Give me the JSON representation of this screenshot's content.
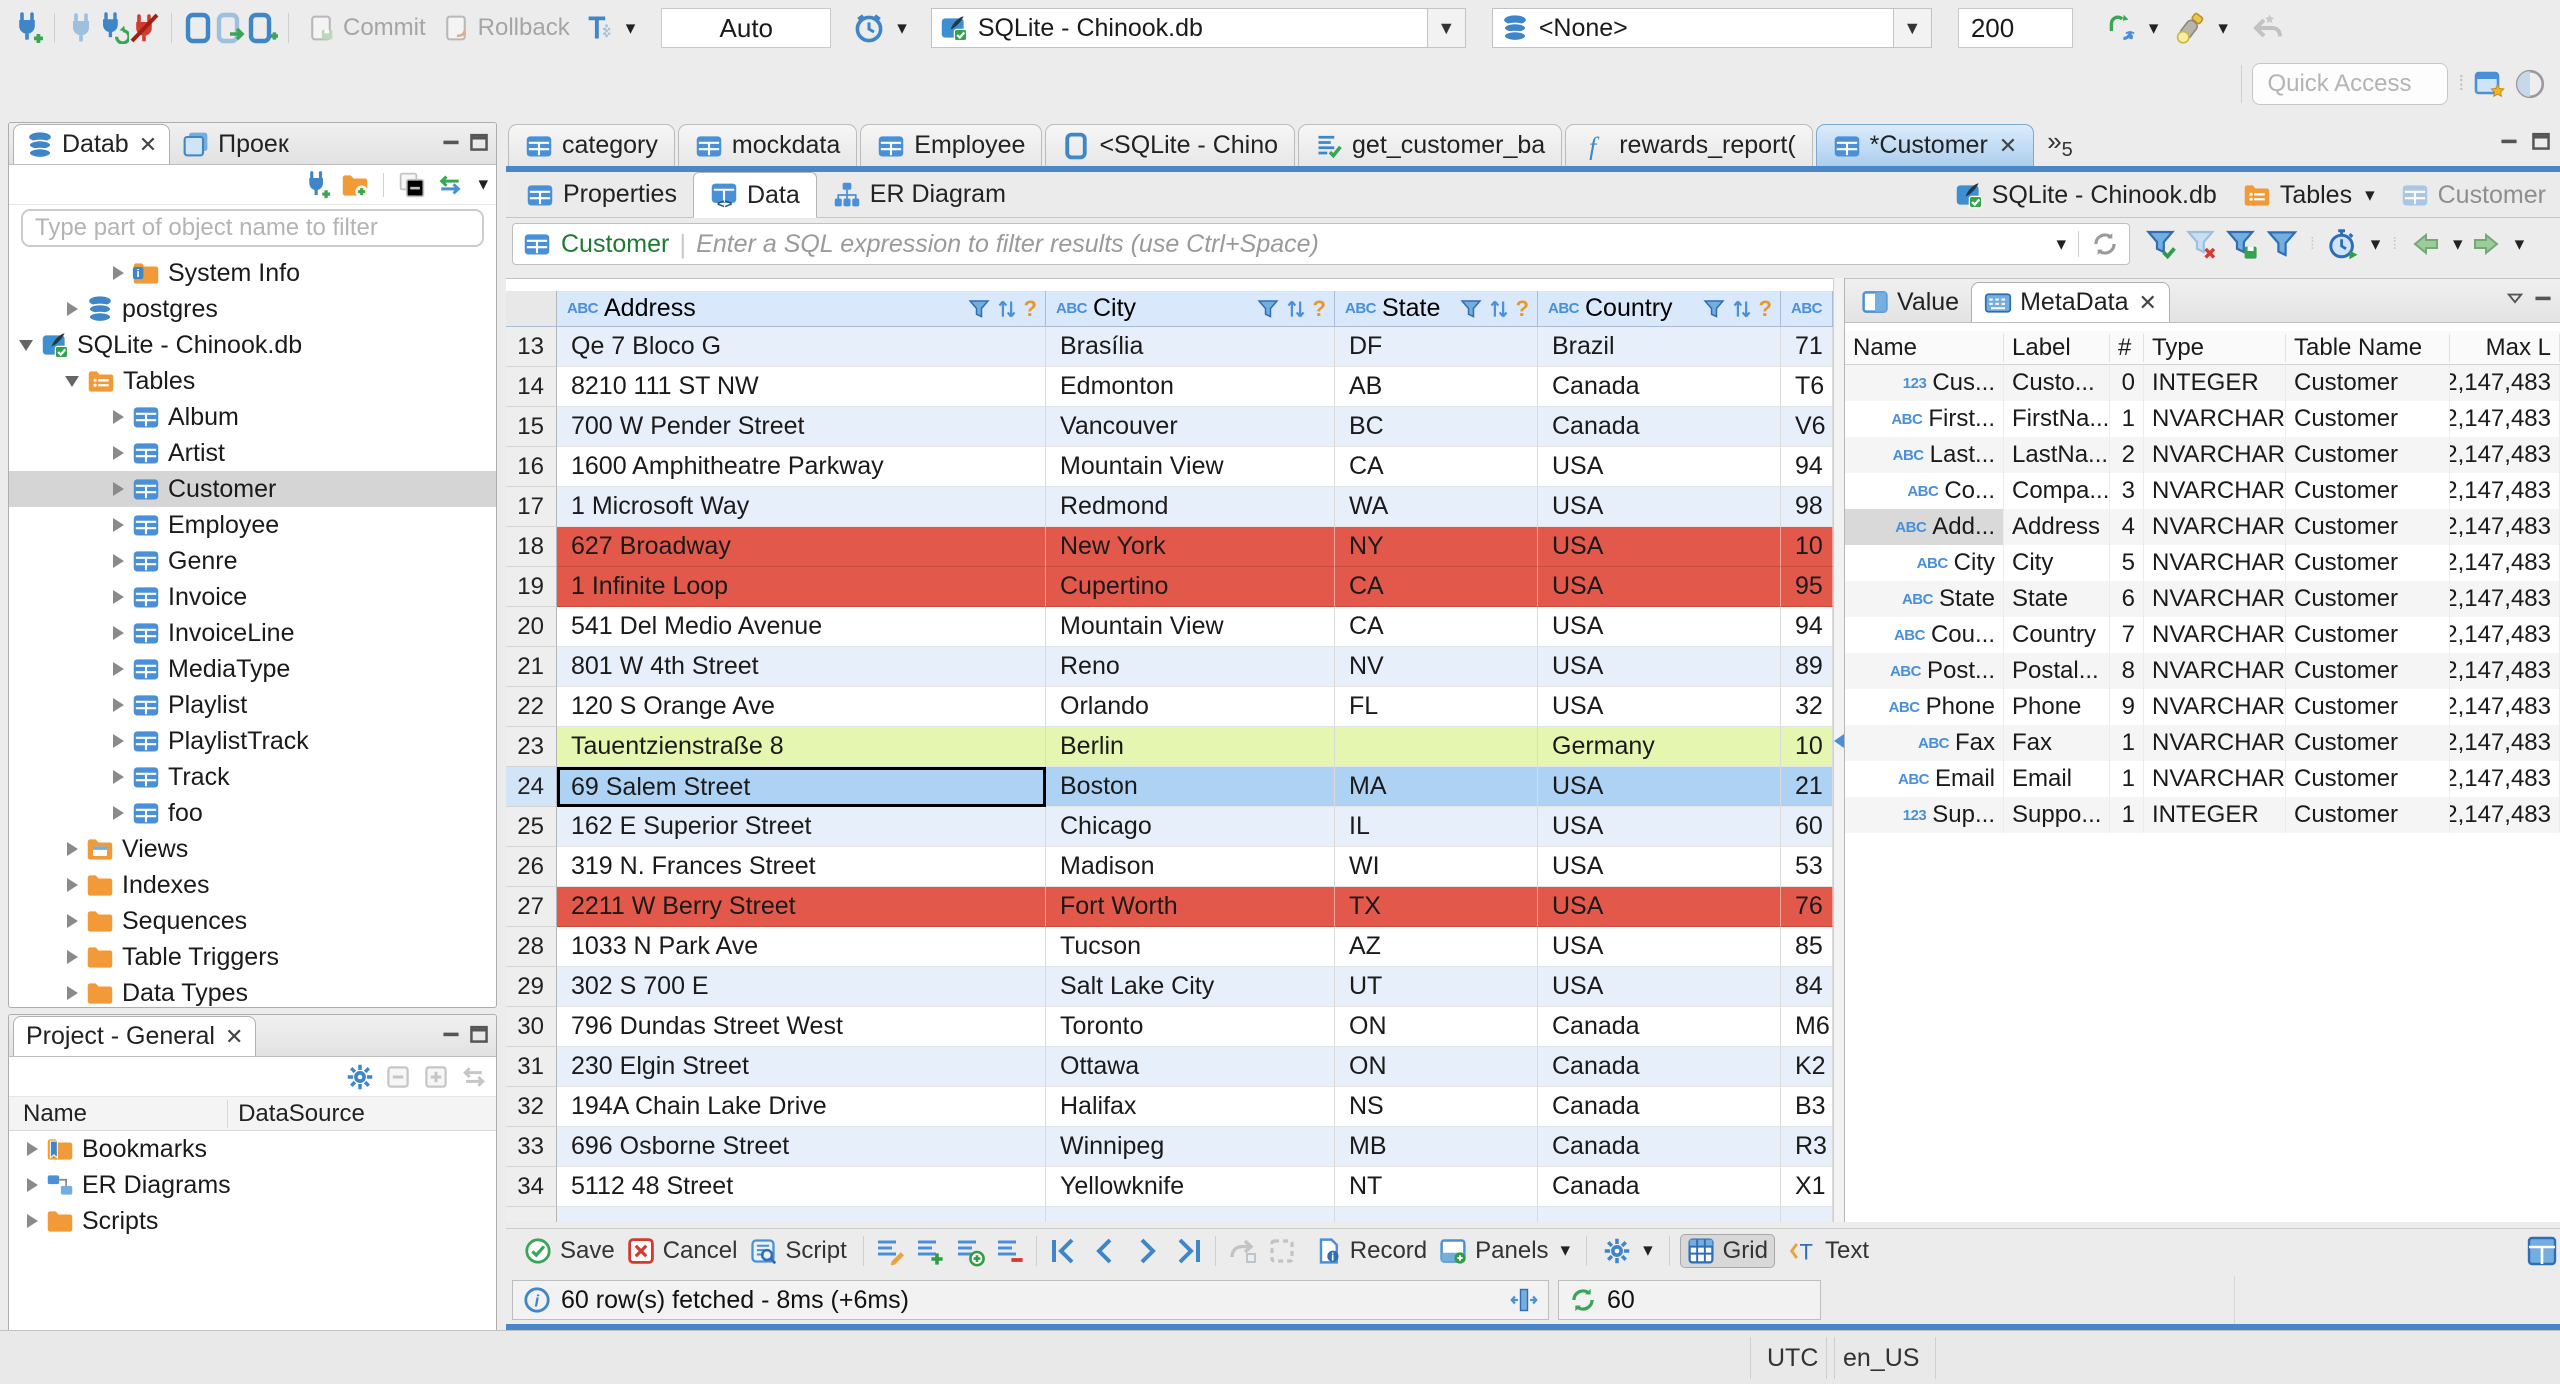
{
  "toolbar": {
    "commit_label": "Commit",
    "rollback_label": "Rollback",
    "txn_mode": "Auto",
    "active_connection": "SQLite - Chinook.db",
    "active_schema": "<None>",
    "fetch_size": "200",
    "quick_access_placeholder": "Quick Access"
  },
  "sidebar": {
    "tab_database": "Datab",
    "tab_projects": "Проек",
    "filter_placeholder": "Type part of object name to filter",
    "tree": [
      {
        "label": "System Info",
        "icon": "folderInfo",
        "indent": 2,
        "arrow": "r"
      },
      {
        "label": "postgres",
        "icon": "db",
        "indent": 1,
        "arrow": "r"
      },
      {
        "label": "SQLite - Chinook.db",
        "icon": "dbFile",
        "indent": 0,
        "arrow": "d"
      },
      {
        "label": "Tables",
        "icon": "folderTable",
        "indent": 1,
        "arrow": "d"
      },
      {
        "label": "Album",
        "icon": "table",
        "indent": 2,
        "arrow": "r"
      },
      {
        "label": "Artist",
        "icon": "table",
        "indent": 2,
        "arrow": "r"
      },
      {
        "label": "Customer",
        "icon": "table",
        "indent": 2,
        "arrow": "r",
        "selected": true
      },
      {
        "label": "Employee",
        "icon": "table",
        "indent": 2,
        "arrow": "r"
      },
      {
        "label": "Genre",
        "icon": "table",
        "indent": 2,
        "arrow": "r"
      },
      {
        "label": "Invoice",
        "icon": "table",
        "indent": 2,
        "arrow": "r"
      },
      {
        "label": "InvoiceLine",
        "icon": "table",
        "indent": 2,
        "arrow": "r"
      },
      {
        "label": "MediaType",
        "icon": "table",
        "indent": 2,
        "arrow": "r"
      },
      {
        "label": "Playlist",
        "icon": "table",
        "indent": 2,
        "arrow": "r"
      },
      {
        "label": "PlaylistTrack",
        "icon": "table",
        "indent": 2,
        "arrow": "r"
      },
      {
        "label": "Track",
        "icon": "table",
        "indent": 2,
        "arrow": "r"
      },
      {
        "label": "foo",
        "icon": "table",
        "indent": 2,
        "arrow": "r"
      },
      {
        "label": "Views",
        "icon": "folderView",
        "indent": 1,
        "arrow": "r"
      },
      {
        "label": "Indexes",
        "icon": "folder",
        "indent": 1,
        "arrow": "r"
      },
      {
        "label": "Sequences",
        "icon": "folder",
        "indent": 1,
        "arrow": "r"
      },
      {
        "label": "Table Triggers",
        "icon": "folder",
        "indent": 1,
        "arrow": "r"
      },
      {
        "label": "Data Types",
        "icon": "folder",
        "indent": 1,
        "arrow": "r"
      }
    ]
  },
  "projects": {
    "title": "Project - General",
    "col_name": "Name",
    "col_datasource": "DataSource",
    "items": [
      {
        "label": "Bookmarks",
        "icon": "folderBookmark"
      },
      {
        "label": "ER Diagrams",
        "icon": "erIcon"
      },
      {
        "label": "Scripts",
        "icon": "folder"
      }
    ]
  },
  "editor_tabs": [
    {
      "label": "category",
      "icon": "table"
    },
    {
      "label": "mockdata",
      "icon": "table"
    },
    {
      "label": "Employee",
      "icon": "table"
    },
    {
      "label": "<SQLite - Chino",
      "icon": "sqlPage"
    },
    {
      "label": "get_customer_ba",
      "icon": "scriptCheck"
    },
    {
      "label": "rewards_report(",
      "icon": "funcIcon"
    },
    {
      "label": "*Customer",
      "icon": "table",
      "active": true,
      "closable": true
    }
  ],
  "tab_overflow_count": "5",
  "result_tabs": [
    {
      "label": "Properties",
      "icon": "table"
    },
    {
      "label": "Data",
      "icon": "tableData",
      "active": true
    },
    {
      "label": "ER Diagram",
      "icon": "diagram"
    }
  ],
  "breadcrumb": {
    "connection": "SQLite - Chinook.db",
    "container": "Tables",
    "entity": "Customer"
  },
  "filter_bar": {
    "entity": "Customer",
    "placeholder": "Enter a SQL expression to filter results (use Ctrl+Space)"
  },
  "grid": {
    "header_badge": "ABC",
    "columns": [
      "Address",
      "City",
      "State",
      "Country"
    ],
    "rows": [
      {
        "num": "13",
        "address": "Qe 7 Bloco G",
        "city": "Brasília",
        "state": "DF",
        "country": "Brazil",
        "extra": "71",
        "style": "stripe"
      },
      {
        "num": "14",
        "address": "8210 111 ST NW",
        "city": "Edmonton",
        "state": "AB",
        "country": "Canada",
        "extra": "T6",
        "style": "plain"
      },
      {
        "num": "15",
        "address": "700 W Pender Street",
        "city": "Vancouver",
        "state": "BC",
        "country": "Canada",
        "extra": "V6",
        "style": "stripe"
      },
      {
        "num": "16",
        "address": "1600 Amphitheatre Parkway",
        "city": "Mountain View",
        "state": "CA",
        "country": "USA",
        "extra": "94",
        "style": "plain"
      },
      {
        "num": "17",
        "address": "1 Microsoft Way",
        "city": "Redmond",
        "state": "WA",
        "country": "USA",
        "extra": "98",
        "style": "stripe"
      },
      {
        "num": "18",
        "address": "627 Broadway",
        "city": "New York",
        "state": "NY",
        "country": "USA",
        "extra": "10",
        "style": "red"
      },
      {
        "num": "19",
        "address": "1 Infinite Loop",
        "city": "Cupertino",
        "state": "CA",
        "country": "USA",
        "extra": "95",
        "style": "red"
      },
      {
        "num": "20",
        "address": "541 Del Medio Avenue",
        "city": "Mountain View",
        "state": "CA",
        "country": "USA",
        "extra": "94",
        "style": "plain"
      },
      {
        "num": "21",
        "address": "801 W 4th Street",
        "city": "Reno",
        "state": "NV",
        "country": "USA",
        "extra": "89",
        "style": "stripe"
      },
      {
        "num": "22",
        "address": "120 S Orange Ave",
        "city": "Orlando",
        "state": "FL",
        "country": "USA",
        "extra": "32",
        "style": "plain"
      },
      {
        "num": "23",
        "address": "Tauentzienstraße 8",
        "city": "Berlin",
        "state": "",
        "country": "Germany",
        "extra": "10",
        "style": "green"
      },
      {
        "num": "24",
        "address": "69 Salem Street",
        "city": "Boston",
        "state": "MA",
        "country": "USA",
        "extra": "21",
        "style": "sel"
      },
      {
        "num": "25",
        "address": "162 E Superior Street",
        "city": "Chicago",
        "state": "IL",
        "country": "USA",
        "extra": "60",
        "style": "stripe"
      },
      {
        "num": "26",
        "address": "319 N. Frances Street",
        "city": "Madison",
        "state": "WI",
        "country": "USA",
        "extra": "53",
        "style": "plain"
      },
      {
        "num": "27",
        "address": "2211 W Berry Street",
        "city": "Fort Worth",
        "state": "TX",
        "country": "USA",
        "extra": "76",
        "style": "red"
      },
      {
        "num": "28",
        "address": "1033 N Park Ave",
        "city": "Tucson",
        "state": "AZ",
        "country": "USA",
        "extra": "85",
        "style": "plain"
      },
      {
        "num": "29",
        "address": "302 S 700 E",
        "city": "Salt Lake City",
        "state": "UT",
        "country": "USA",
        "extra": "84",
        "style": "stripe"
      },
      {
        "num": "30",
        "address": "796 Dundas Street West",
        "city": "Toronto",
        "state": "ON",
        "country": "Canada",
        "extra": "M6",
        "style": "plain"
      },
      {
        "num": "31",
        "address": "230 Elgin Street",
        "city": "Ottawa",
        "state": "ON",
        "country": "Canada",
        "extra": "K2",
        "style": "stripe"
      },
      {
        "num": "32",
        "address": "194A Chain Lake Drive",
        "city": "Halifax",
        "state": "NS",
        "country": "Canada",
        "extra": "B3",
        "style": "plain"
      },
      {
        "num": "33",
        "address": "696 Osborne Street",
        "city": "Winnipeg",
        "state": "MB",
        "country": "Canada",
        "extra": "R3",
        "style": "stripe"
      },
      {
        "num": "34",
        "address": "5112 48 Street",
        "city": "Yellowknife",
        "state": "NT",
        "country": "Canada",
        "extra": "X1",
        "style": "plain"
      }
    ]
  },
  "meta_panel": {
    "tab_value": "Value",
    "tab_metadata": "MetaData",
    "badge_text": "ABC",
    "badge_number": "123",
    "columns": [
      "Name",
      "Label",
      "#",
      "Type",
      "Table Name",
      "Max L"
    ],
    "rows": [
      {
        "kind": "123",
        "name": "Cus...",
        "label": "Custo...",
        "num": "0",
        "type": "INTEGER",
        "table": "Customer",
        "max": "2,147,483"
      },
      {
        "kind": "ABC",
        "name": "First...",
        "label": "FirstNa...",
        "num": "1",
        "type": "NVARCHAR",
        "table": "Customer",
        "max": "2,147,483"
      },
      {
        "kind": "ABC",
        "name": "Last...",
        "label": "LastNa...",
        "num": "2",
        "type": "NVARCHAR",
        "table": "Customer",
        "max": "2,147,483"
      },
      {
        "kind": "ABC",
        "name": "Co...",
        "label": "Compa...",
        "num": "3",
        "type": "NVARCHAR",
        "table": "Customer",
        "max": "2,147,483"
      },
      {
        "kind": "ABC",
        "name": "Add...",
        "label": "Address",
        "num": "4",
        "type": "NVARCHAR",
        "table": "Customer",
        "max": "2,147,483",
        "selected": true
      },
      {
        "kind": "ABC",
        "name": "City",
        "label": "City",
        "num": "5",
        "type": "NVARCHAR",
        "table": "Customer",
        "max": "2,147,483"
      },
      {
        "kind": "ABC",
        "name": "State",
        "label": "State",
        "num": "6",
        "type": "NVARCHAR",
        "table": "Customer",
        "max": "2,147,483"
      },
      {
        "kind": "ABC",
        "name": "Cou...",
        "label": "Country",
        "num": "7",
        "type": "NVARCHAR",
        "table": "Customer",
        "max": "2,147,483"
      },
      {
        "kind": "ABC",
        "name": "Post...",
        "label": "Postal...",
        "num": "8",
        "type": "NVARCHAR",
        "table": "Customer",
        "max": "2,147,483"
      },
      {
        "kind": "ABC",
        "name": "Phone",
        "label": "Phone",
        "num": "9",
        "type": "NVARCHAR",
        "table": "Customer",
        "max": "2,147,483"
      },
      {
        "kind": "ABC",
        "name": "Fax",
        "label": "Fax",
        "num": "1",
        "type": "NVARCHAR",
        "table": "Customer",
        "max": "2,147,483"
      },
      {
        "kind": "ABC",
        "name": "Email",
        "label": "Email",
        "num": "1",
        "type": "NVARCHAR",
        "table": "Customer",
        "max": "2,147,483"
      },
      {
        "kind": "123",
        "name": "Sup...",
        "label": "Suppo...",
        "num": "1",
        "type": "INTEGER",
        "table": "Customer",
        "max": "2,147,483"
      }
    ]
  },
  "bottom_toolbar": {
    "save": "Save",
    "cancel": "Cancel",
    "script": "Script",
    "record": "Record",
    "panels": "Panels",
    "grid": "Grid",
    "text": "Text"
  },
  "status": {
    "message": "60 row(s) fetched - 8ms (+6ms)",
    "fetch_count": "60"
  },
  "statusbar": {
    "timezone": "UTC",
    "locale": "en_US"
  },
  "colors": {
    "accent_blue": "#4a87c9",
    "header_blue": "#d9e8fa",
    "stripe_blue": "#e7f0fa",
    "selected_blue": "#aed2f4",
    "error_red": "#e2594b",
    "new_green": "#e5f6b0",
    "folder_orange": "#f29a38",
    "icon_blue": "#4a90d9"
  }
}
